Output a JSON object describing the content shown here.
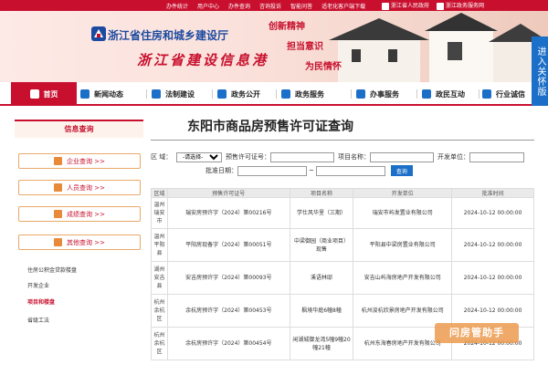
{
  "topbar": {
    "links": [
      "办件统计",
      "用户中心",
      "办件查询",
      "咨询投诉",
      "智能问答",
      "适老化客户端下载"
    ],
    "right_links": [
      "浙江省人民政府",
      "浙江政务服务网"
    ]
  },
  "banner": {
    "dept_title": "浙江省住房和城乡建设厅",
    "site_title": "浙江省建设信息港",
    "slogans": [
      "创新精神",
      "担当意识",
      "为民情怀"
    ]
  },
  "side_float": "进入关怀版",
  "nav": {
    "items": [
      {
        "label": "首页",
        "icon": "home-icon",
        "active": true
      },
      {
        "label": "新闻动态",
        "icon": "news-icon",
        "active": false
      },
      {
        "label": "法制建设",
        "icon": "law-icon",
        "active": false
      },
      {
        "label": "政务公开",
        "icon": "document-icon",
        "active": false
      },
      {
        "label": "政务服务",
        "icon": "service-icon",
        "active": false
      },
      {
        "label": "办事服务",
        "icon": "handle-icon",
        "active": false
      },
      {
        "label": "政民互动",
        "icon": "interact-icon",
        "active": false
      },
      {
        "label": "行业诚信",
        "icon": "credit-icon",
        "active": false
      }
    ]
  },
  "sidebar": {
    "title": "信息查询",
    "buttons": [
      "企业查询 >>",
      "人员查询 >>",
      "成绩查询 >>",
      "其他查询 >>"
    ],
    "links": [
      "住房公积金贷款楼盘",
      "开发企业",
      "项目和楼盘",
      "省级工法"
    ],
    "current_link": "项目和楼盘"
  },
  "main": {
    "title": "东阳市商品房预售许可证查询",
    "form": {
      "region_label": "区    域：",
      "region_value": "-请选择-",
      "permit_label": "预售许可证号：",
      "project_label": "项目名称：",
      "developer_label": "开发单位：",
      "date_label": "批准日期：",
      "date_sep": "~",
      "search_button": "查询"
    },
    "table": {
      "headers": [
        "区域",
        "预售许可证号",
        "项目名称",
        "开发单位",
        "批准时间"
      ],
      "rows": [
        {
          "region": "温州瑞安市",
          "permit": "瑞安房预许字（2024）第00216号",
          "project": "学仕风华里（三期）",
          "developer": "瑞安市屿发置业有限公司",
          "date": "2024-10-12 00:00:00"
        },
        {
          "region": "温州平阳县",
          "permit": "平阳房现备字（2024）第00051号",
          "project": "中梁御园（商业项目）现售",
          "developer": "平阳县中梁房置业有限公司",
          "date": "2024-10-12 00:00:00"
        },
        {
          "region": "湖州安吉县",
          "permit": "安吉房预许字（2024）第00093号",
          "project": "溪语林邸",
          "developer": "安吉山屿海房地产开发有限公司",
          "date": "2024-10-12 00:00:00"
        },
        {
          "region": "杭州余杭区",
          "permit": "余杭房预许字（2024）第00453号",
          "project": "枫境华庭6幢8幢",
          "developer": "杭州浚杭欣景房地产开发有限公司",
          "date": "2024-10-12 00:00:00"
        },
        {
          "region": "杭州余杭区",
          "permit": "余杭房预许字（2024）第00454号",
          "project": "闲湖城御龙湾5幢9幢20幢21幢",
          "developer": "杭州东海春房地产开发有限公司",
          "date": "2024-10-12 00:00:00"
        }
      ]
    }
  },
  "watermark": "问房管助手",
  "colors": {
    "brand_red": "#c8102e",
    "nav_blue": "#1c6fc8",
    "accent_orange": "#e8a86a"
  }
}
